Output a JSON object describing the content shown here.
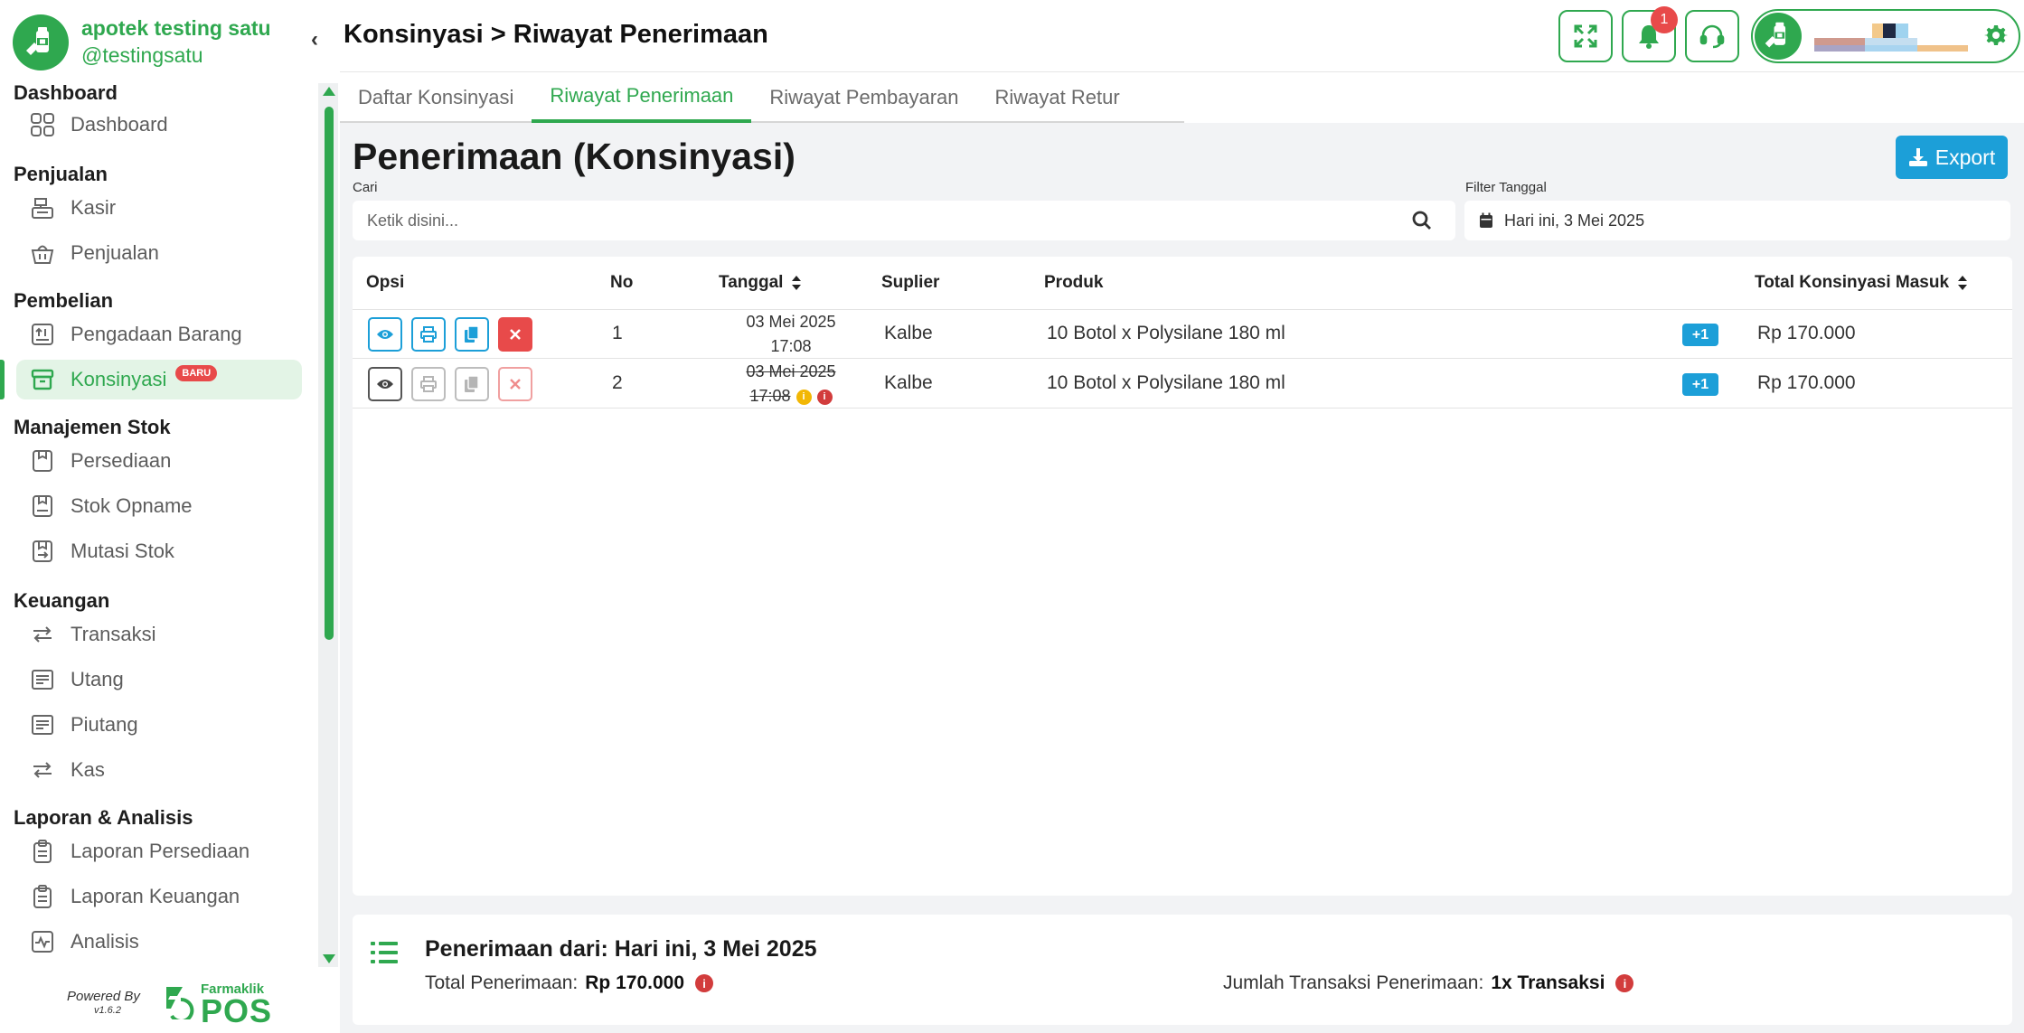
{
  "app": {
    "name": "apotek testing satu",
    "handle": "@testingsatu"
  },
  "sidebar": {
    "collapse_glyph": "‹",
    "sections": [
      {
        "title": "Dashboard",
        "items": [
          {
            "label": "Dashboard",
            "icon": "grid-icon"
          }
        ]
      },
      {
        "title": "Penjualan",
        "items": [
          {
            "label": "Kasir",
            "icon": "cash-register-icon"
          },
          {
            "label": "Penjualan",
            "icon": "basket-icon"
          }
        ]
      },
      {
        "title": "Pembelian",
        "items": [
          {
            "label": "Pengadaan Barang",
            "icon": "procurement-icon"
          },
          {
            "label": "Konsinyasi",
            "icon": "archive-box-icon",
            "badge": "BARU",
            "active": true
          }
        ]
      },
      {
        "title": "Manajemen Stok",
        "items": [
          {
            "label": "Persediaan",
            "icon": "inventory-icon"
          },
          {
            "label": "Stok Opname",
            "icon": "stock-opname-icon"
          },
          {
            "label": "Mutasi Stok",
            "icon": "stock-mutation-icon"
          }
        ]
      },
      {
        "title": "Keuangan",
        "items": [
          {
            "label": "Transaksi",
            "icon": "transfer-arrows-icon"
          },
          {
            "label": "Utang",
            "icon": "ledger-icon"
          },
          {
            "label": "Piutang",
            "icon": "ledger-icon"
          },
          {
            "label": "Kas",
            "icon": "transfer-arrows-icon"
          }
        ]
      },
      {
        "title": "Laporan & Analisis",
        "items": [
          {
            "label": "Laporan Persediaan",
            "icon": "clipboard-icon"
          },
          {
            "label": "Laporan Keuangan",
            "icon": "clipboard-icon"
          },
          {
            "label": "Analisis",
            "icon": "pulse-chart-icon"
          }
        ]
      }
    ],
    "footer": {
      "powered_by": "Powered By",
      "version": "v1.6.2",
      "brand_small": "Farmaklik",
      "brand_big": "POS"
    }
  },
  "header": {
    "title": "Konsinyasi > Riwayat Penerimaan",
    "notification_count": "1",
    "icons": [
      "fullscreen-icon",
      "bell-icon",
      "headset-icon",
      "gear-icon"
    ]
  },
  "tabs": [
    {
      "label": "Daftar Konsinyasi",
      "active": false
    },
    {
      "label": "Riwayat Penerimaan",
      "active": true
    },
    {
      "label": "Riwayat Pembayaran",
      "active": false
    },
    {
      "label": "Riwayat Retur",
      "active": false
    }
  ],
  "content": {
    "title": "Penerimaan (Konsinyasi)",
    "export_label": "Export",
    "search": {
      "label": "Cari",
      "placeholder": "Ketik disini...",
      "value": ""
    },
    "date_filter": {
      "label": "Filter Tanggal",
      "value": "Hari ini, 3 Mei 2025"
    }
  },
  "table": {
    "headers": {
      "opsi": "Opsi",
      "no": "No",
      "tanggal": "Tanggal",
      "suplier": "Suplier",
      "produk": "Produk",
      "total": "Total Konsinyasi Masuk"
    },
    "rows": [
      {
        "no": "1",
        "date": "03 Mei 2025",
        "time": "17:08",
        "supplier": "Kalbe",
        "product": "10 Botol x Polysilane 180 ml",
        "extra": "+1",
        "total": "Rp 170.000",
        "cancelled": false
      },
      {
        "no": "2",
        "date": "03 Mei 2025",
        "time": "17:08",
        "supplier": "Kalbe",
        "product": "10 Botol x Polysilane 180 ml",
        "extra": "+1",
        "total": "Rp 170.000",
        "cancelled": true
      }
    ]
  },
  "summary": {
    "title": "Penerimaan dari: Hari ini, 3 Mei 2025",
    "total_label": "Total Penerimaan:",
    "total_value": "Rp 170.000",
    "count_label": "Jumlah Transaksi Penerimaan:",
    "count_value": "1x Transaksi"
  },
  "colors": {
    "brand_green": "#2fa84f",
    "accent_blue": "#1c9fd8",
    "danger_red": "#e84a4a",
    "warning_yellow": "#f2b705"
  }
}
